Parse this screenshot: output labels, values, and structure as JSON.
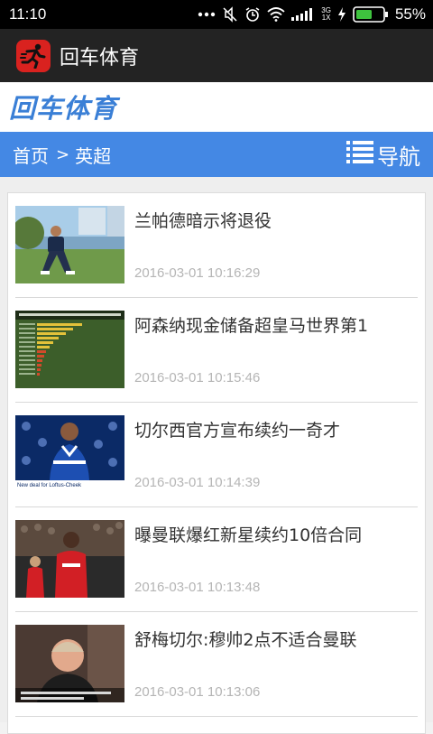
{
  "status_bar": {
    "time": "11:10",
    "network_top": "3G",
    "network_bottom": "1X",
    "battery": "55%"
  },
  "app_bar": {
    "title": "回车体育",
    "logo_icon": "running-man-icon",
    "logo_color": "#d9221f"
  },
  "site": {
    "logo_text": "回车体育",
    "accent_color": "#4488e4"
  },
  "navbar": {
    "breadcrumb_home": "首页",
    "breadcrumb_sep": ">",
    "breadcrumb_current": "英超",
    "menu_label": "导航",
    "menu_icon": "list-icon"
  },
  "news": [
    {
      "title": "兰帕德暗示将退役",
      "time": "2016-03-01 10:16:29"
    },
    {
      "title": "阿森纳现金储备超皇马世界第1",
      "time": "2016-03-01 10:15:46"
    },
    {
      "title": "切尔西官方宣布续约一奇才",
      "time": "2016-03-01 10:14:39",
      "thumb_caption": "New deal for Loftus-Cheek"
    },
    {
      "title": "曝曼联爆红新星续约10倍合同",
      "time": "2016-03-01 10:13:48"
    },
    {
      "title": "舒梅切尔:穆帅2点不适合曼联",
      "time": "2016-03-01 10:13:06"
    }
  ]
}
